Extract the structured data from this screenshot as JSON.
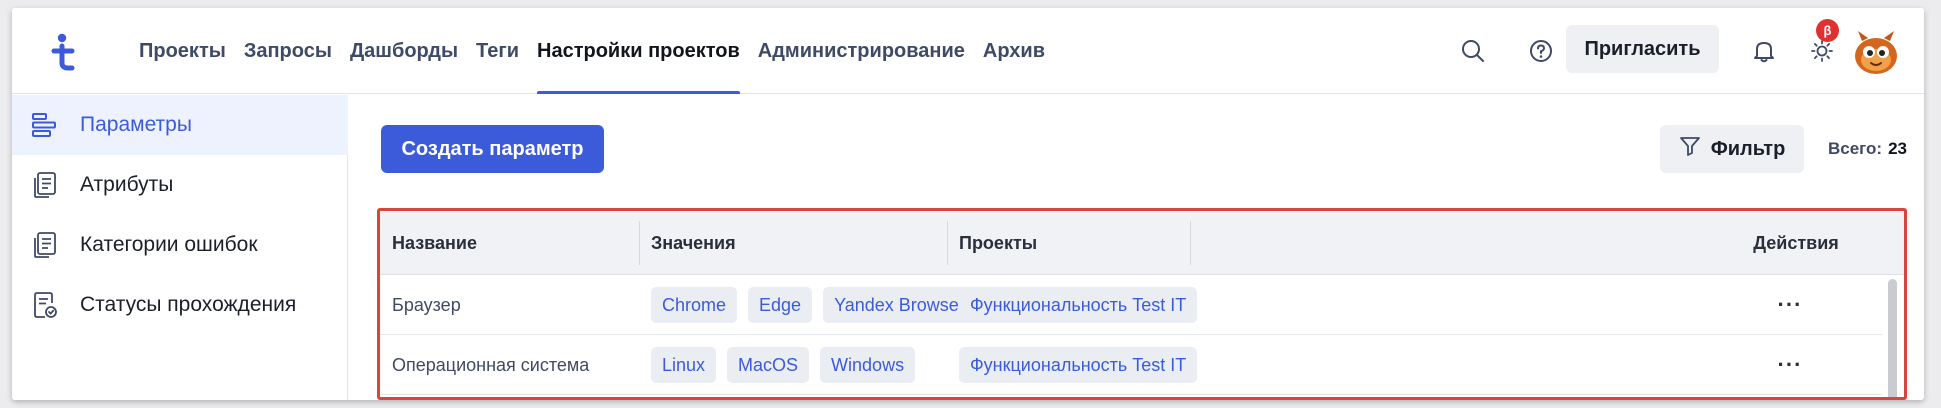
{
  "nav": {
    "items": [
      {
        "label": "Проекты",
        "active": false
      },
      {
        "label": "Запросы",
        "active": false
      },
      {
        "label": "Дашборды",
        "active": false
      },
      {
        "label": "Теги",
        "active": false
      },
      {
        "label": "Настройки проектов",
        "active": true
      },
      {
        "label": "Администрирование",
        "active": false
      },
      {
        "label": "Архив",
        "active": false
      }
    ],
    "invite_label": "Пригласить",
    "beta_badge": "β"
  },
  "sidebar": {
    "items": [
      {
        "label": "Параметры",
        "icon": "parameters-icon",
        "active": true
      },
      {
        "label": "Атрибуты",
        "icon": "attributes-icon",
        "active": false
      },
      {
        "label": "Категории ошибок",
        "icon": "error-categories-icon",
        "active": false
      },
      {
        "label": "Статусы прохождения",
        "icon": "run-statuses-icon",
        "active": false
      }
    ]
  },
  "toolbar": {
    "create_label": "Создать параметр",
    "filter_label": "Фильтр",
    "total_label": "Всего:",
    "total_value": "23"
  },
  "table": {
    "columns": [
      "Название",
      "Значения",
      "Проекты",
      "Действия"
    ],
    "rows": [
      {
        "name": "Браузер",
        "values": [
          "Chrome",
          "Edge",
          "Yandex Browser"
        ],
        "projects": [
          "Функциональность Test IT"
        ],
        "actions": "···"
      },
      {
        "name": "Операционная система",
        "values": [
          "Linux",
          "MacOS",
          "Windows"
        ],
        "projects": [
          "Функциональность Test IT"
        ],
        "actions": "···"
      }
    ]
  },
  "colors": {
    "accent": "#3b5bdb",
    "highlight_border": "#d9453c",
    "badge": "#e03131"
  }
}
